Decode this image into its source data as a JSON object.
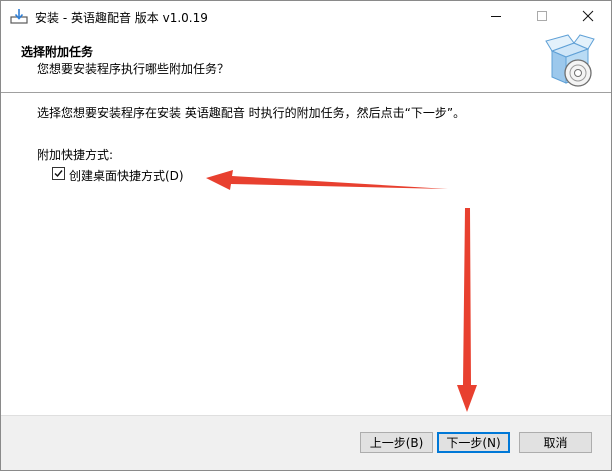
{
  "window": {
    "title": "安装 - 英语趣配音 版本 v1.0.19"
  },
  "header": {
    "title": "选择附加任务",
    "subtitle": "您想要安装程序执行哪些附加任务？"
  },
  "body": {
    "description": "选择您想要安装程序在安装 英语趣配音 时执行的附加任务，然后点击“下一步”。",
    "group_label": "附加快捷方式:",
    "tasks": [
      {
        "label": "创建桌面快捷方式(D)",
        "checked": true
      }
    ]
  },
  "buttons": {
    "back": "上一步(B)",
    "next": "下一步(N)",
    "cancel": "取消"
  },
  "icons": {
    "app": "installer-app-icon",
    "header": "box-cd-icon",
    "annotation_color": "#e8402f"
  }
}
